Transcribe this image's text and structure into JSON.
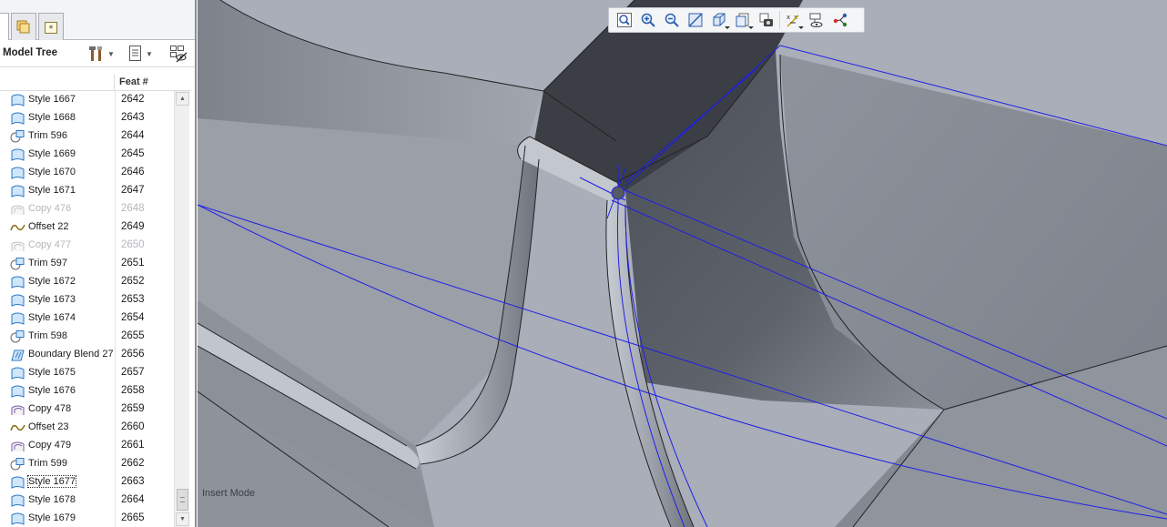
{
  "panel": {
    "tabs": [
      {
        "icon": "model-tree-tab-icon"
      },
      {
        "icon": "folder-browser-tab-icon"
      },
      {
        "icon": "favorites-tab-icon"
      }
    ],
    "title": "Model Tree",
    "toolbar": {
      "settings_icon": "tools-icon",
      "show_icon": "show-icon",
      "filter_icon": "tree-filter-icon"
    },
    "columns": {
      "name": "",
      "feat": "Feat #"
    }
  },
  "tree": {
    "rows": [
      {
        "label": "Style 1667",
        "feat": "2642",
        "type": "style",
        "suppressed": false
      },
      {
        "label": "Style 1668",
        "feat": "2643",
        "type": "style",
        "suppressed": false
      },
      {
        "label": "Trim 596",
        "feat": "2644",
        "type": "trim",
        "suppressed": false
      },
      {
        "label": "Style 1669",
        "feat": "2645",
        "type": "style",
        "suppressed": false
      },
      {
        "label": "Style 1670",
        "feat": "2646",
        "type": "style",
        "suppressed": false
      },
      {
        "label": "Style 1671",
        "feat": "2647",
        "type": "style",
        "suppressed": false
      },
      {
        "label": "Copy 476",
        "feat": "2648",
        "type": "copy",
        "suppressed": true
      },
      {
        "label": "Offset 22",
        "feat": "2649",
        "type": "offset",
        "suppressed": false
      },
      {
        "label": "Copy 477",
        "feat": "2650",
        "type": "copy",
        "suppressed": true
      },
      {
        "label": "Trim 597",
        "feat": "2651",
        "type": "trim",
        "suppressed": false
      },
      {
        "label": "Style 1672",
        "feat": "2652",
        "type": "style",
        "suppressed": false
      },
      {
        "label": "Style 1673",
        "feat": "2653",
        "type": "style",
        "suppressed": false
      },
      {
        "label": "Style 1674",
        "feat": "2654",
        "type": "style",
        "suppressed": false
      },
      {
        "label": "Trim 598",
        "feat": "2655",
        "type": "trim",
        "suppressed": false
      },
      {
        "label": "Boundary Blend 27",
        "feat": "2656",
        "type": "blend",
        "suppressed": false
      },
      {
        "label": "Style 1675",
        "feat": "2657",
        "type": "style",
        "suppressed": false
      },
      {
        "label": "Style 1676",
        "feat": "2658",
        "type": "style",
        "suppressed": false
      },
      {
        "label": "Copy 478",
        "feat": "2659",
        "type": "copy",
        "suppressed": false
      },
      {
        "label": "Offset 23",
        "feat": "2660",
        "type": "offset",
        "suppressed": false
      },
      {
        "label": "Copy 479",
        "feat": "2661",
        "type": "copy",
        "suppressed": false
      },
      {
        "label": "Trim 599",
        "feat": "2662",
        "type": "trim",
        "suppressed": false
      },
      {
        "label": "Style 1677",
        "feat": "2663",
        "type": "style",
        "suppressed": false,
        "focused": true
      },
      {
        "label": "Style 1678",
        "feat": "2664",
        "type": "style",
        "suppressed": false
      },
      {
        "label": "Style 1679",
        "feat": "2665",
        "type": "style",
        "suppressed": false
      }
    ]
  },
  "viewport": {
    "mode_label": "Insert Mode",
    "toolbar": [
      "refit-icon",
      "zoom-in-icon",
      "zoom-out-icon",
      "repaint-icon",
      "display-style-icon",
      "saved-views-icon",
      "view-manager-icon",
      "datum-display-icon",
      "annotation-display-icon",
      "spin-center-icon"
    ],
    "colors": {
      "edge": "#0000ff",
      "geometry": "#222222"
    }
  }
}
